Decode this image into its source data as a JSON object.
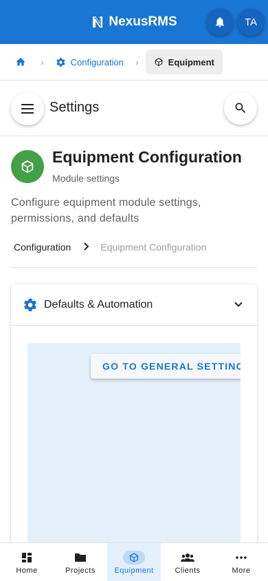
{
  "app": {
    "brand": "NexusRMS",
    "avatar_initials": "TA",
    "brand_color": "#1976d2"
  },
  "breadcrumb": {
    "config_label": "Configuration",
    "current_label": "Equipment"
  },
  "settings_bar": {
    "title": "Settings"
  },
  "header": {
    "title": "Equipment Configuration",
    "subtitle": "Module settings",
    "description": "Configure equipment module settings, permissions, and defaults",
    "module_color": "#43a047"
  },
  "sub_breadcrumb": {
    "link": "Configuration",
    "current": "Equipment Configuration"
  },
  "accordion": {
    "title": "Defaults & Automation",
    "button_label": "GO TO GENERAL SETTINGS"
  },
  "bottom_nav": {
    "items": [
      {
        "label": "Home",
        "icon": "dashboard-icon"
      },
      {
        "label": "Projects",
        "icon": "folder-icon"
      },
      {
        "label": "Equipment",
        "icon": "cube-icon",
        "active": true
      },
      {
        "label": "Clients",
        "icon": "people-icon"
      },
      {
        "label": "More",
        "icon": "more-icon"
      }
    ]
  }
}
